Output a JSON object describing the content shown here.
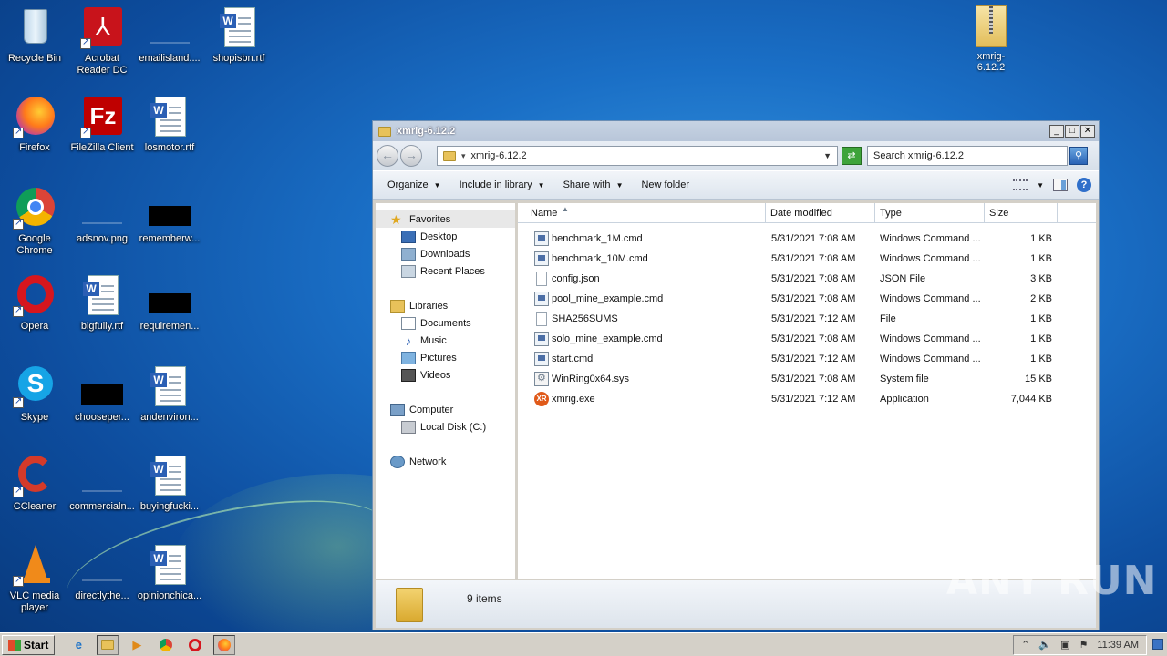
{
  "desktop": {
    "icons": [
      {
        "label": "Recycle Bin"
      },
      {
        "label": "Acrobat Reader DC"
      },
      {
        "label": "emailisland...."
      },
      {
        "label": "shopisbn.rtf"
      },
      {
        "label": "Firefox"
      },
      {
        "label": "FileZilla Client"
      },
      {
        "label": "losmotor.rtf"
      },
      {
        "label": "Google Chrome"
      },
      {
        "label": "adsnov.png"
      },
      {
        "label": "rememberw..."
      },
      {
        "label": "Opera"
      },
      {
        "label": "bigfully.rtf"
      },
      {
        "label": "requiremen..."
      },
      {
        "label": "Skype"
      },
      {
        "label": "chooseper..."
      },
      {
        "label": "andenviron..."
      },
      {
        "label": "CCleaner"
      },
      {
        "label": "commercialn..."
      },
      {
        "label": "buyingfucki..."
      },
      {
        "label": "VLC media player"
      },
      {
        "label": "directlythe..."
      },
      {
        "label": "opinionchica..."
      }
    ],
    "top_right_folder": "xmrig-6.12.2",
    "watermark": "ANY RUN"
  },
  "explorer": {
    "title": "xmrig-6.12.2",
    "window_buttons": {
      "minimize": "_",
      "maximize": "□",
      "close": "✕"
    },
    "address": "xmrig-6.12.2",
    "search_placeholder": "Search xmrig-6.12.2",
    "toolbar": {
      "organize": "Organize",
      "include_in_library": "Include in library",
      "share_with": "Share with",
      "new_folder": "New folder"
    },
    "nav": {
      "favorites": "Favorites",
      "desktop": "Desktop",
      "downloads": "Downloads",
      "recent_places": "Recent Places",
      "libraries": "Libraries",
      "documents": "Documents",
      "music": "Music",
      "pictures": "Pictures",
      "videos": "Videos",
      "computer": "Computer",
      "local_disk": "Local Disk (C:)",
      "network": "Network"
    },
    "columns": {
      "name": "Name",
      "date": "Date modified",
      "type": "Type",
      "size": "Size"
    },
    "files": [
      {
        "name": "benchmark_1M.cmd",
        "date": "5/31/2021 7:08 AM",
        "type": "Windows Command ...",
        "size": "1 KB",
        "icon": "cmd"
      },
      {
        "name": "benchmark_10M.cmd",
        "date": "5/31/2021 7:08 AM",
        "type": "Windows Command ...",
        "size": "1 KB",
        "icon": "cmd"
      },
      {
        "name": "config.json",
        "date": "5/31/2021 7:08 AM",
        "type": "JSON File",
        "size": "3 KB",
        "icon": "file"
      },
      {
        "name": "pool_mine_example.cmd",
        "date": "5/31/2021 7:08 AM",
        "type": "Windows Command ...",
        "size": "2 KB",
        "icon": "cmd"
      },
      {
        "name": "SHA256SUMS",
        "date": "5/31/2021 7:12 AM",
        "type": "File",
        "size": "1 KB",
        "icon": "file"
      },
      {
        "name": "solo_mine_example.cmd",
        "date": "5/31/2021 7:08 AM",
        "type": "Windows Command ...",
        "size": "1 KB",
        "icon": "cmd"
      },
      {
        "name": "start.cmd",
        "date": "5/31/2021 7:12 AM",
        "type": "Windows Command ...",
        "size": "1 KB",
        "icon": "cmd"
      },
      {
        "name": "WinRing0x64.sys",
        "date": "5/31/2021 7:08 AM",
        "type": "System file",
        "size": "15 KB",
        "icon": "sys"
      },
      {
        "name": "xmrig.exe",
        "date": "5/31/2021 7:12 AM",
        "type": "Application",
        "size": "7,044 KB",
        "icon": "exe"
      }
    ],
    "status": "9 items"
  },
  "taskbar": {
    "start": "Start",
    "clock": "11:39 AM"
  }
}
